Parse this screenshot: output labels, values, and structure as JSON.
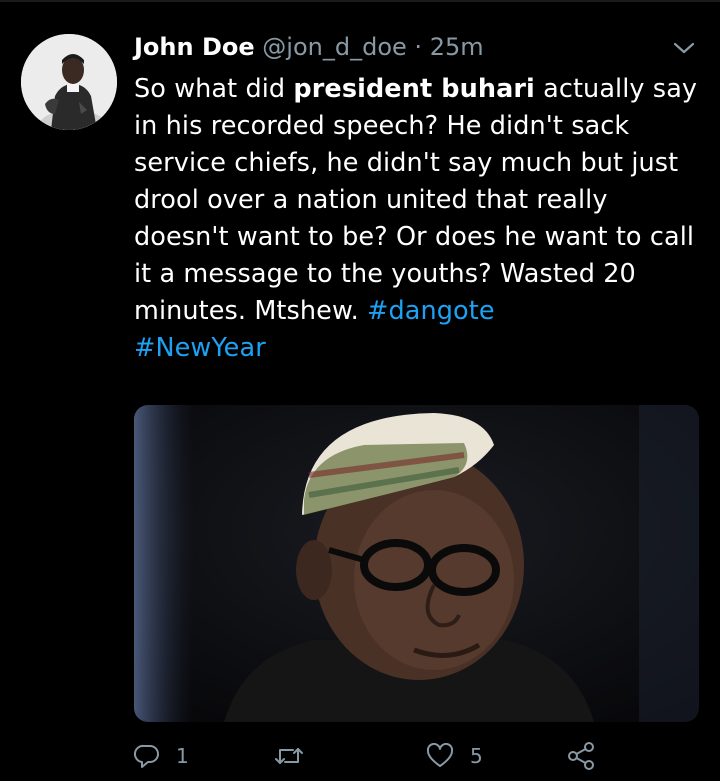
{
  "tweet": {
    "display_name": "John Doe",
    "handle": "@jon_d_doe",
    "separator": "·",
    "time": "25m",
    "text_intro": "So what did ",
    "text_bold": "president buhari",
    "text_main": " actually say in his recorded speech? He didn't sack service chiefs, he didn't say much but just drool over a nation united that really doesn't want to be? Or does he want to call it a message to the youths? Wasted 20 minutes. Mtshew. ",
    "hashtag_1": "#dangote",
    "hashtag_2": "#NewYear"
  },
  "actions": {
    "reply_count": "1",
    "retweet_count": "",
    "like_count": "5"
  },
  "icons": [
    "avatar",
    "caret-down-icon",
    "reply-icon",
    "retweet-icon",
    "like-icon",
    "share-icon"
  ],
  "colors": {
    "background": "#000000",
    "text": "#ffffff",
    "muted": "#8899a6",
    "link": "#1da1f2"
  }
}
